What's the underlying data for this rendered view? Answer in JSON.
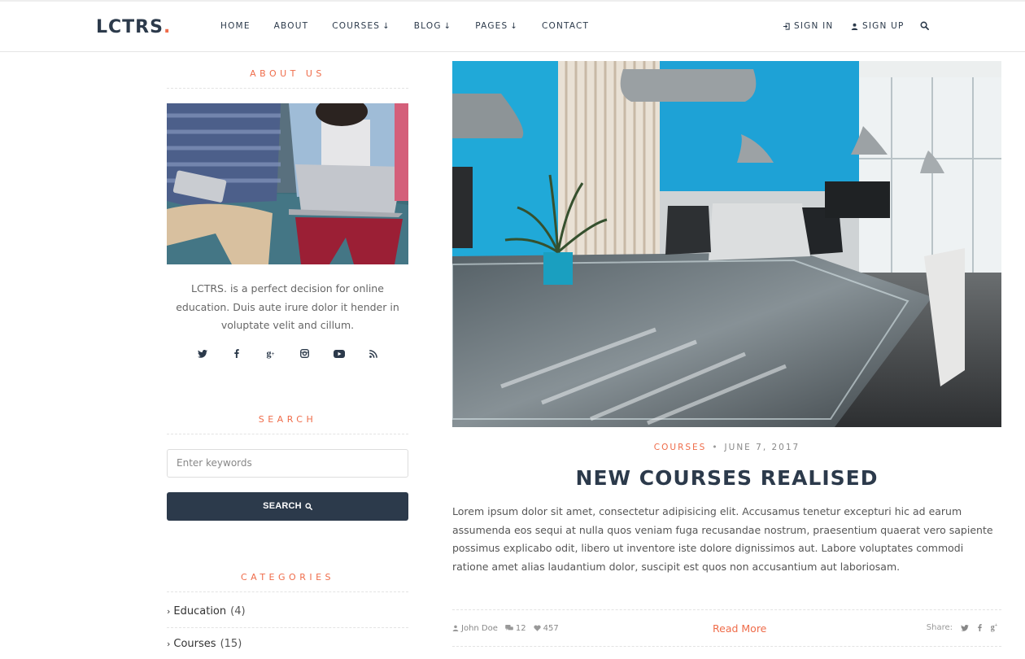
{
  "brand": {
    "name": "LCTRS",
    "dot": "."
  },
  "nav": {
    "items": [
      {
        "label": "HOME",
        "dropdown": false
      },
      {
        "label": "ABOUT",
        "dropdown": false
      },
      {
        "label": "COURSES",
        "dropdown": true
      },
      {
        "label": "BLOG",
        "dropdown": true
      },
      {
        "label": "PAGES",
        "dropdown": true
      },
      {
        "label": "CONTACT",
        "dropdown": false
      }
    ],
    "sign_in": "SIGN IN",
    "sign_up": "SIGN UP"
  },
  "sidebar": {
    "about": {
      "title": "ABOUT US",
      "text": "LCTRS. is a perfect decision for online education. Duis aute irure dolor it hender in voluptate velit and cillum."
    },
    "social": [
      "twitter-icon",
      "facebook-icon",
      "google-plus-icon",
      "instagram-icon",
      "youtube-icon",
      "rss-icon"
    ],
    "search": {
      "title": "SEARCH",
      "placeholder": "Enter keywords",
      "value": "",
      "button_label": "SEARCH"
    },
    "categories": {
      "title": "CATEGORIES",
      "items": [
        {
          "label": "Education",
          "count": "(4)"
        },
        {
          "label": "Courses",
          "count": "(15)"
        }
      ]
    }
  },
  "post": {
    "category": "COURSES",
    "separator": "•",
    "date": "JUNE 7, 2017",
    "title": "NEW COURSES REALISED",
    "body": "Lorem ipsum dolor sit amet, consectetur adipisicing elit. Accusamus tenetur excepturi hic ad earum assumenda eos sequi at nulla quos veniam fuga recusandae nostrum, praesentium quaerat vero sapiente possimus explicabo odit, libero ut inventore iste dolore dignissimos aut. Labore voluptates commodi ratione amet alias laudantium dolor, suscipit est quos non accusantium aut laboriosam.",
    "author": "John Doe",
    "comments": "12",
    "likes": "457",
    "read_more": "Read More",
    "share_label": "Share:"
  },
  "colors": {
    "accent": "#ef6c4a",
    "navy": "#2c3a4b"
  }
}
